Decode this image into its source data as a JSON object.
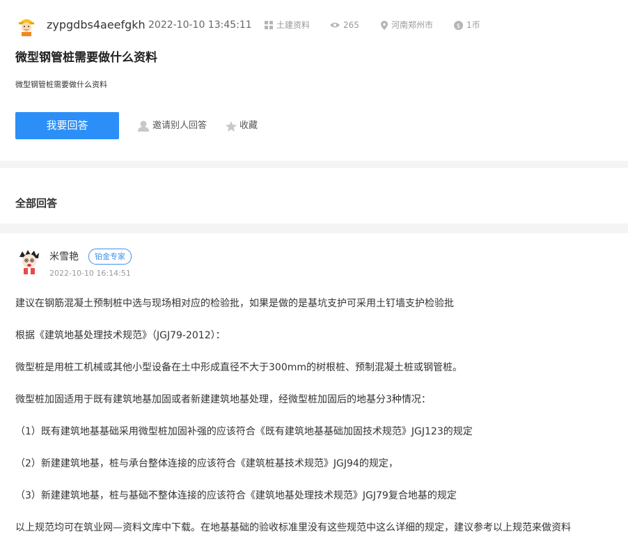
{
  "question": {
    "username": "zypgdbs4aeefgkh",
    "date": "2022-10-10 13:45:11",
    "category": "土建资料",
    "views": "265",
    "location": "河南郑州市",
    "coins": "1币",
    "title": "微型钢管桩需要做什么资料",
    "description": "微型钢管桩需要做什么资料"
  },
  "actions": {
    "answer_label": "我要回答",
    "invite_label": "邀请别人回答",
    "favorite_label": "收藏"
  },
  "answers_section": {
    "title": "全部回答"
  },
  "answer": {
    "name": "米雪艳",
    "badge": "铂金专家",
    "date": "2022-10-10 16:14:51",
    "paragraphs": [
      "建议在钢筋混凝土预制桩中选与现场相对应的检验批，如果是做的是基坑支护可采用土钉墙支护检验批",
      "根据《建筑地基处理技术规范》（JGJ79-2012）：",
      "微型桩是用桩工机械或其他小型设备在土中形成直径不大于300mm的树根桩、预制混凝土桩或钢管桩。",
      "微型桩加固适用于既有建筑地基加固或者新建建筑地基处理，经微型桩加固后的地基分3种情况：",
      "（1）既有建筑地基基础采用微型桩加固补强的应该符合《既有建筑地基基础加固技术规范》JGJ123的规定",
      "（2）新建建筑地基，桩与承台整体连接的应该符合《建筑桩基技术规范》JGJ94的规定，",
      "（3）新建建筑地基，桩与基础不整体连接的应该符合《建筑地基处理技术规范》JGJ79复合地基的规定",
      "以上规范均可在筑业网—资料文库中下载。在地基基础的验收标准里没有这些规范中这么详细的规定，建议参考以上规范来做资料"
    ]
  },
  "colors": {
    "primary_button": "#2b8ff7",
    "badge": "#3d8ff0",
    "divider": "#f4f4f4"
  },
  "icons": {
    "category": "grid-icon",
    "views": "eye-icon",
    "location": "location-pin-icon",
    "coins": "coin-icon",
    "invite": "user-icon",
    "favorite": "star-icon"
  }
}
